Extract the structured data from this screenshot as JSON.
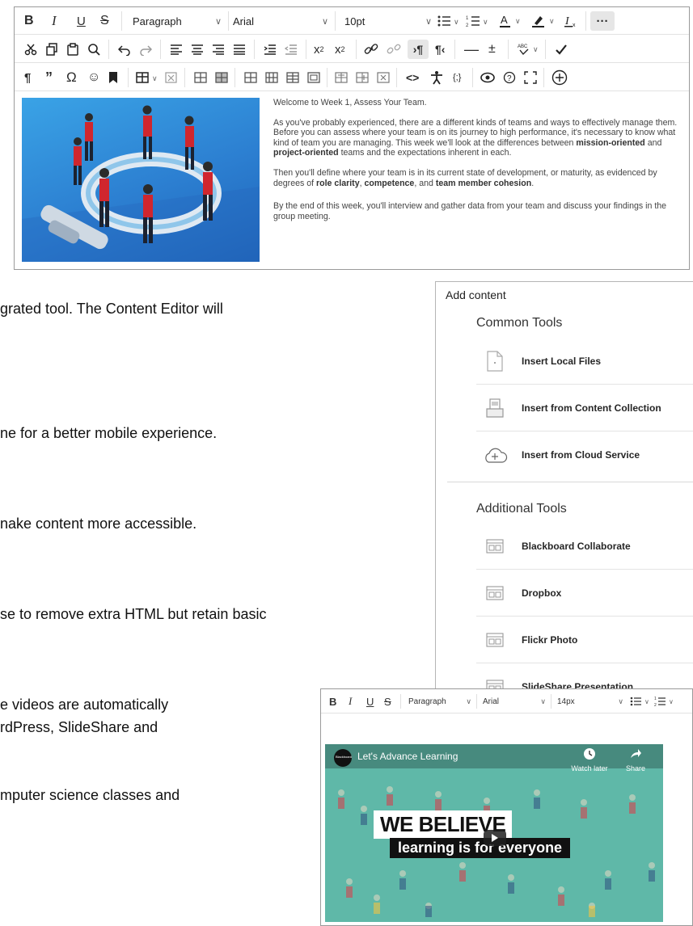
{
  "editor": {
    "toolbar": {
      "block_format": "Paragraph",
      "font_family": "Arial",
      "font_size": "10pt"
    },
    "content": {
      "p1": "Welcome to Week 1, Assess Your Team.",
      "p2_a": "As you've probably experienced, there are a different kinds of teams and ways to effectively manage them. Before you can assess where your team is on its journey to high performance, it's necessary to know what kind of team you are managing. This week we'll look at the differences between ",
      "p2_b1": "mission-oriented",
      "p2_c": " and ",
      "p2_b2": "project-oriented",
      "p2_d": " teams and the expectations inherent in each.",
      "p3_a": "Then you'll define where your team is in its current state of development, or maturity, as evidenced by degrees of ",
      "p3_b1": "role clarity",
      "p3_c": ", ",
      "p3_b2": "competence",
      "p3_d": ", and ",
      "p3_b3": "team member cohesion",
      "p3_e": ".",
      "p4": "By the end of this week, you'll interview and gather data from your team and discuss your findings in the group meeting."
    }
  },
  "background_text": [
    "grated tool. The Content Editor will",
    "ne for a better mobile experience.",
    "nake content more accessible.",
    "se to remove extra HTML but retain basic",
    "e videos are automatically",
    "rdPress, SlideShare and",
    "mputer science classes and"
  ],
  "panel": {
    "title": "Add content",
    "common_heading": "Common Tools",
    "common_tools": [
      "Insert Local Files",
      "Insert from Content Collection",
      "Insert from Cloud Service"
    ],
    "additional_heading": "Additional Tools",
    "additional_tools": [
      "Blackboard Collaborate",
      "Dropbox",
      "Flickr Photo",
      "SlideShare Presentation"
    ]
  },
  "editor2": {
    "toolbar": {
      "block_format": "Paragraph",
      "font_family": "Arial",
      "font_size": "14px"
    },
    "video": {
      "channel": "Blackboard",
      "title": "Let's Advance Learning",
      "watch_later": "Watch later",
      "share": "Share",
      "banner1": "WE BELIEVE",
      "banner2": "learning is for everyone"
    }
  },
  "colors": {
    "illustration_bg": "#2c7fd1",
    "figure_red": "#d0262e",
    "video_bg": "#5fb8a8"
  }
}
